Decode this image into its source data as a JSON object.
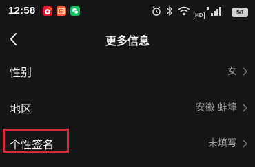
{
  "status_bar": {
    "time": "12:58",
    "notification_icons": [
      "weibo-icon",
      "notes-icon",
      "wechat-icon"
    ],
    "system_icons": [
      "alarm-icon",
      "bluetooth-icon",
      "wifi-icon",
      "hd-icon",
      "signal-icon"
    ],
    "hd_label": "HD",
    "battery": "58"
  },
  "nav": {
    "title": "更多信息",
    "back_icon": "chevron-left-icon"
  },
  "rows": [
    {
      "label": "性别",
      "value": "女"
    },
    {
      "label": "地区",
      "value": "安徽 蚌埠"
    },
    {
      "label": "个性签名",
      "value": "未填写"
    }
  ],
  "colors": {
    "background": "#161616",
    "text": "#f2f2f2",
    "secondary_text": "#9a9a9a",
    "highlight": "#d9283b"
  }
}
